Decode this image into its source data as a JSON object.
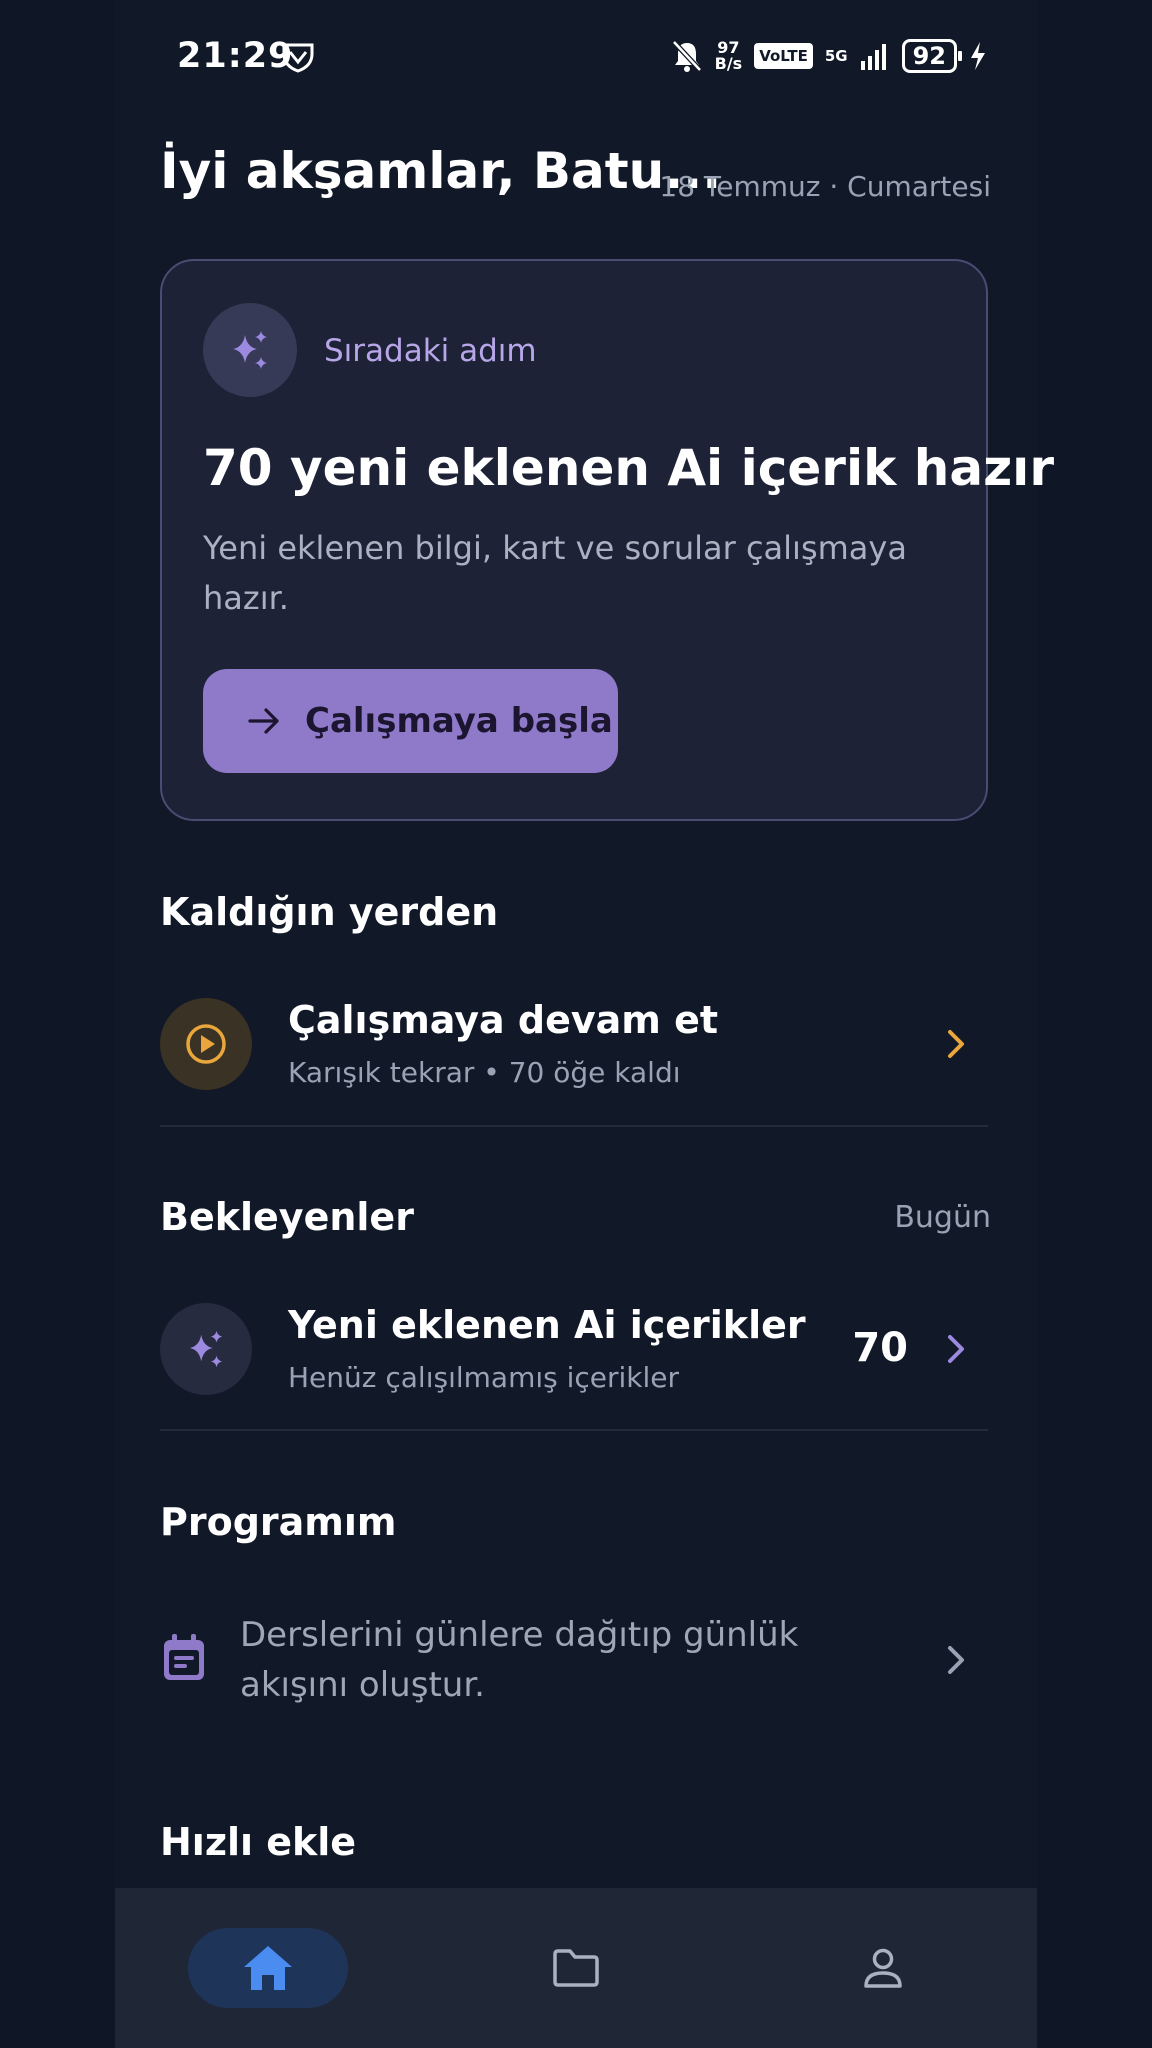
{
  "status_bar": {
    "time": "21:29",
    "net_speed_value": "97",
    "net_speed_unit": "B/s",
    "volte": "VoLTE",
    "network": "5G",
    "battery": "92"
  },
  "header": {
    "greeting": "İyi akşamlar, Batu...",
    "date": "18 Temmuz · Cumartesi"
  },
  "hero_card": {
    "tag": "Sıradaki adım",
    "title": "70 yeni eklenen Ai içerik hazır",
    "description": "Yeni eklenen bilgi, kart ve sorular çalışmaya hazır.",
    "button_label": "Çalışmaya başla"
  },
  "resume_section": {
    "title": "Kaldığın yerden",
    "item": {
      "title": "Çalışmaya devam et",
      "subtitle": "Karışık tekrar • 70 öğe kaldı"
    }
  },
  "pending_section": {
    "title": "Bekleyenler",
    "right_label": "Bugün",
    "item": {
      "title": "Yeni eklenen Ai içerikler",
      "subtitle": "Henüz çalışılmamış içerikler",
      "count": "70"
    }
  },
  "program_section": {
    "title": "Programım",
    "text": "Derslerini günlere dağıtıp günlük akışını oluştur."
  },
  "quick_add_section": {
    "title": "Hızlı ekle"
  },
  "colors": {
    "accent_purple": "#8f7ac9",
    "accent_orange": "#e9a63c",
    "nav_active": "#4a8cf0",
    "background": "#111827"
  },
  "nav": [
    "home-icon",
    "folder-icon",
    "profile-icon"
  ]
}
